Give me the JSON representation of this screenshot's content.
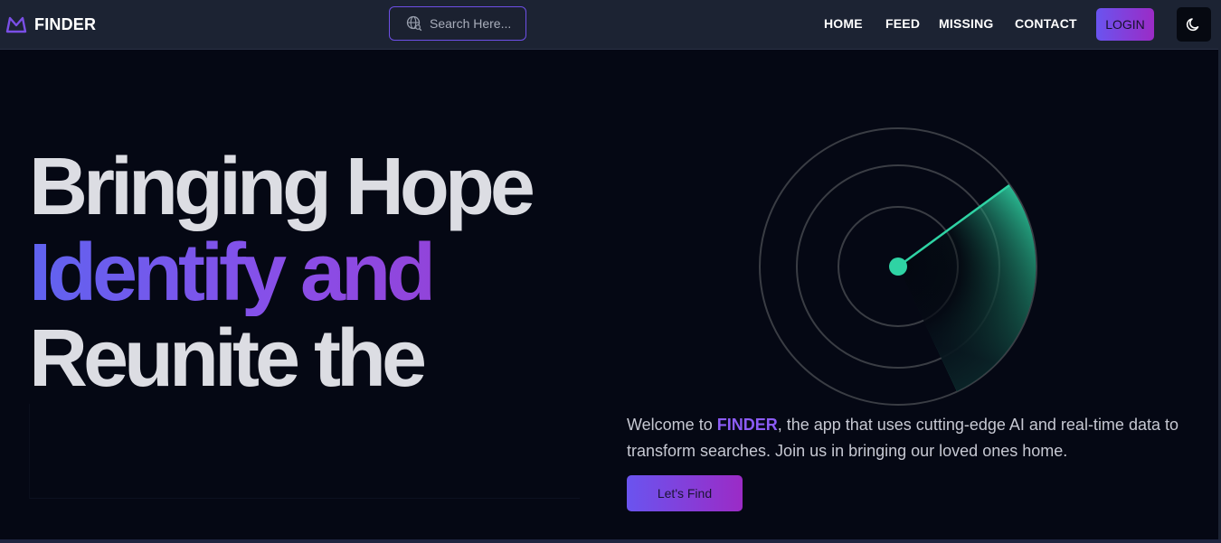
{
  "app": {
    "name": "FINDER"
  },
  "search": {
    "placeholder": "Search Here..."
  },
  "nav": {
    "links": [
      "HOME",
      "FEED",
      "MISSING",
      "CONTACT"
    ],
    "login_label": "LOGIN",
    "theme_icon": "moon-icon"
  },
  "hero": {
    "headline_line1": "Bringing Hope",
    "headline_line2": "Identify and",
    "headline_line3": "Reunite the",
    "description_prefix": "Welcome to ",
    "description_brand": "FINDER",
    "description_suffix": ", the app that uses cutting-edge AI and real-time data to transform searches. Join us in bringing our loved ones home.",
    "cta_label": "Let's Find"
  },
  "colors": {
    "accent": "#8c5cf6",
    "gradient_start": "#6a54ef",
    "gradient_end": "#9b2bc6",
    "radar": "#2fd3a4",
    "navbar": "#1c2333",
    "background": "#050814"
  },
  "icons": {
    "logo": "finder-logo-icon",
    "search": "globe-search-icon",
    "theme": "moon-icon",
    "radar": "radar-icon"
  }
}
